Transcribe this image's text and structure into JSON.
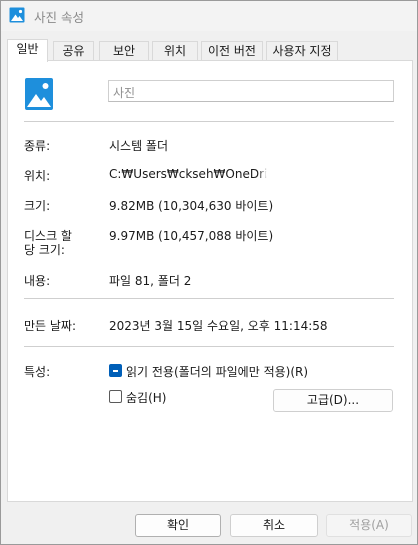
{
  "window": {
    "title": "사진 속성",
    "colors": {
      "accent": "#005fb8",
      "icon_blue": "#1e8fdc"
    }
  },
  "tabs": [
    {
      "label": "일반",
      "active": true
    },
    {
      "label": "공유",
      "active": false
    },
    {
      "label": "보안",
      "active": false
    },
    {
      "label": "위치",
      "active": false
    },
    {
      "label": "이전 버전",
      "active": false
    },
    {
      "label": "사용자 지정",
      "active": false
    }
  ],
  "general": {
    "icon": "picture-folder-icon",
    "name_value": "사진",
    "type_label": "종류:",
    "type_value": "시스템 폴더",
    "location_label": "위치:",
    "location_value": "C:₩Users₩ckseh₩OneDrive",
    "size_label": "크기:",
    "size_value": "9.82MB (10,304,630 바이트)",
    "disk_size_label_line1": "디스크 할",
    "disk_size_label_line2": "당 크기:",
    "disk_size_value": "9.97MB (10,457,088 바이트)",
    "contains_label": "내용:",
    "contains_value": "파일 81, 폴더 2",
    "created_label": "만든 날짜:",
    "created_value": "2023년 3월 15일 수요일, 오후 11:14:58",
    "attributes_label": "특성:",
    "readonly_label": "읽기 전용(폴더의 파일에만 적용)(R)",
    "readonly_state": "indeterminate",
    "hidden_label": "숨김(H)",
    "hidden_checked": false,
    "advanced_button": "고급(D)..."
  },
  "footer": {
    "ok": "확인",
    "cancel": "취소",
    "apply": "적용(A)"
  }
}
